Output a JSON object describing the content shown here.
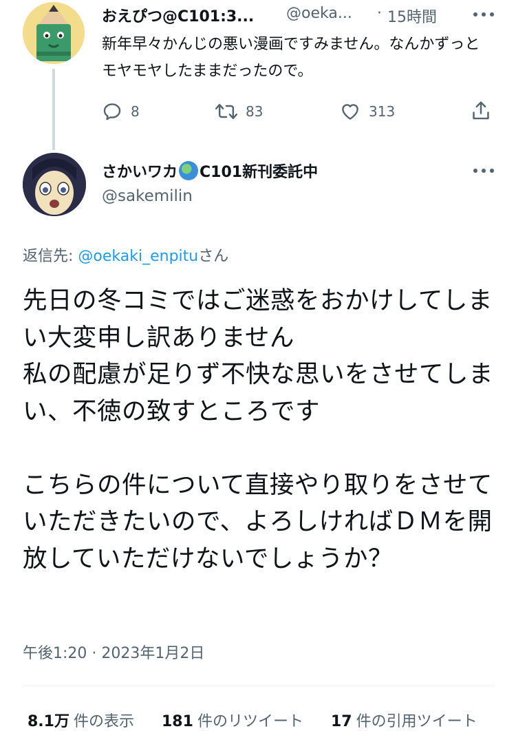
{
  "parent_tweet": {
    "avatar": "pencil-character-avatar",
    "display_name": "おえぴつ@C101:3...",
    "handle": "@oeka...",
    "separator": "·",
    "time": "15時間",
    "text": "新年早々かんじの悪い漫画ですみません。なんかずっとモヤモヤしたままだったので。",
    "actions": {
      "reply_icon": "comment-icon",
      "reply_count": "8",
      "retweet_icon": "retweet-icon",
      "retweet_count": "83",
      "like_icon": "heart-icon",
      "like_count": "313",
      "share_icon": "share-icon"
    }
  },
  "main_tweet": {
    "avatar": "anime-character-avatar",
    "display_name_prefix": "さかいワカ",
    "display_name_emoji": "globe-emoji",
    "display_name_suffix": "C101新刊委託中",
    "handle": "@sakemilin",
    "reply_prefix": "返信先: ",
    "reply_handle": "@oekaki_enpitu",
    "reply_suffix": "さん",
    "body": "先日の冬コミではご迷惑をおかけしてしまい大変申し訳ありません\n私の配慮が足りず不快な思いをさせてしまい、不徳の致すところです\n\nこちらの件について直接やり取りをさせていただきたいので、よろしければＤＭを開放していただけないでしょうか？",
    "timestamp": "午後1:20 · 2023年1月2日",
    "stats": [
      {
        "value": "8.1万",
        "label": "件の表示"
      },
      {
        "value": "181",
        "label": "件のリツイート"
      },
      {
        "value": "17",
        "label": "件の引用ツイート"
      }
    ]
  },
  "colors": {
    "text": "#0f1419",
    "secondary": "#536471",
    "link": "#1d9bf0",
    "divider": "#eff3f4"
  }
}
